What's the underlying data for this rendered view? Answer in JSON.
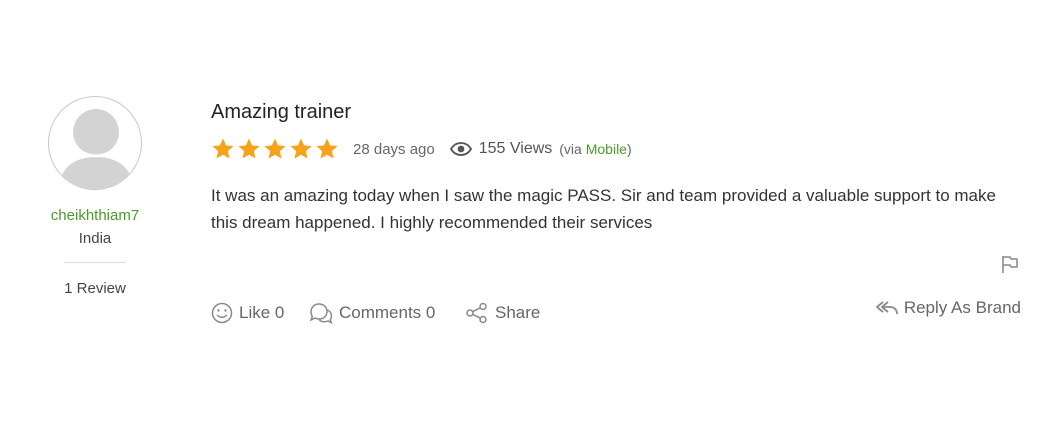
{
  "reviewer": {
    "username": "cheikhthiam7",
    "country": "India",
    "review_count": "1 Review"
  },
  "review": {
    "title": "Amazing trainer",
    "rating": 5,
    "max_rating": 5,
    "time_ago": "28 days ago",
    "views": "155 Views",
    "via_prefix": "(via",
    "via_source": "Mobile",
    "via_suffix": ")",
    "body": "It was an amazing today when I saw the magic PASS. Sir and team provided a valuable support to make this dream happened. I highly recommended their services"
  },
  "actions": {
    "like_label": "Like 0",
    "comments_label": "Comments 0",
    "share_label": "Share",
    "reply_label": "Reply As Brand"
  },
  "icons": {
    "avatar": "avatar-placeholder-icon",
    "star": "star-icon",
    "views": "eye-icon",
    "flag": "flag-icon",
    "like": "smiley-icon",
    "comments": "chat-bubbles-icon",
    "share": "share-icon",
    "reply": "reply-all-icon"
  },
  "colors": {
    "star": "#f7a21b",
    "brand_green": "#4c9a2a",
    "text": "#333333",
    "muted": "#666666"
  }
}
